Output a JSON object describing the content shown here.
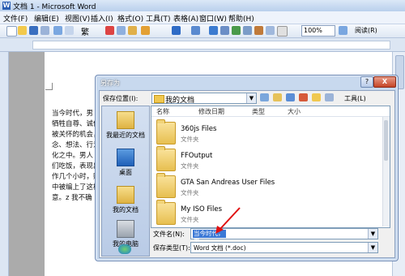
{
  "window": {
    "title": "文档 1 - Microsoft Word"
  },
  "menu": [
    "文件(F)",
    "编辑(E)",
    "视图(V)",
    "插入(I)",
    "格式(O)",
    "工具(T)",
    "表格(A)",
    "窗口(W)",
    "帮助(H)"
  ],
  "toolbar": {
    "font_glyph": "繁",
    "zoom": "100%",
    "reading": "阅读(R)"
  },
  "document": {
    "lines": [
      "当今时代，男",
      "牺牲自尊、诚信",
      "被关怀的机会，",
      "念、想法、行为",
      "化之中。男人",
      "们吃饭，表现出",
      "作几个小时，赚到",
      "中被编上了这样",
      "意。z 我不确"
    ]
  },
  "dialog": {
    "title": "另存为",
    "help": "?",
    "close": "X",
    "save_in_label": "保存位置(I):",
    "save_in_value": "我的文档",
    "tools_label": "工具(L)",
    "columns": {
      "name": "名称",
      "modified": "修改日期",
      "type": "类型",
      "size": "大小"
    },
    "places": [
      "我最近的文档",
      "桌面",
      "我的文档",
      "我的电脑"
    ],
    "files": [
      {
        "name": "360js Files",
        "type": "文件夹"
      },
      {
        "name": "FFOutput",
        "type": "文件夹"
      },
      {
        "name": "GTA San Andreas User Files",
        "type": "文件夹"
      },
      {
        "name": "My ISO Files",
        "type": "文件夹"
      }
    ],
    "filename_label": "文件名(N):",
    "filename_value": "当今时代，男",
    "filetype_label": "保存类型(T):",
    "filetype_value": "Word 文档 (*.doc)"
  },
  "colors": {
    "accent": "#3b79d6",
    "dialog_frame": "#c8d9ee",
    "arrow": "#e01010"
  }
}
